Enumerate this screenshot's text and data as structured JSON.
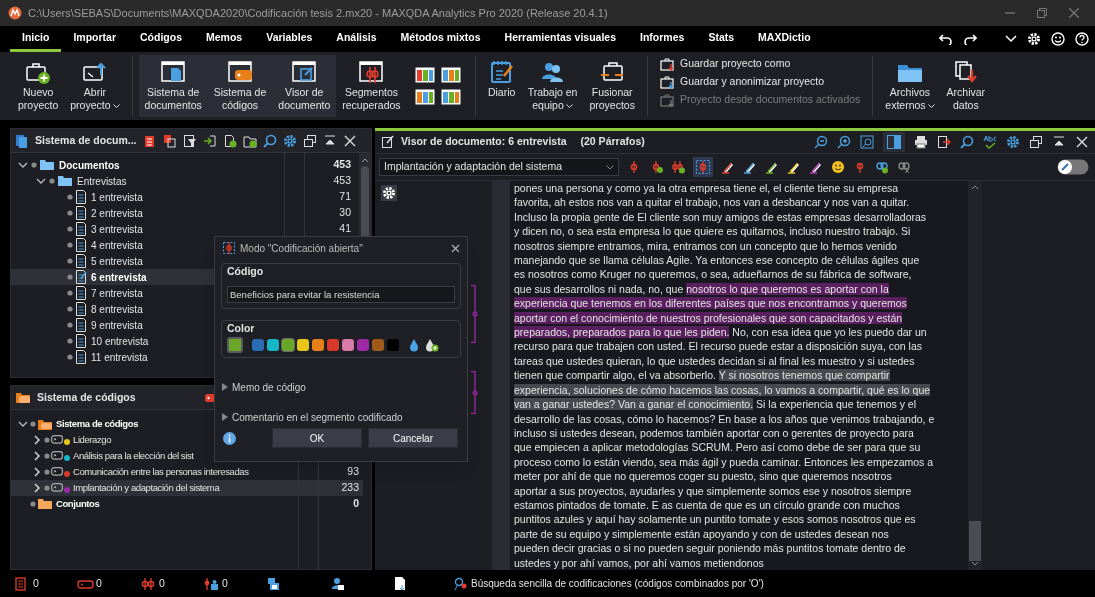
{
  "window": {
    "title": "C:\\Users\\SEBAS\\Documents\\MAXQDA2020\\Codificación tesis 2.mx20 - MAXQDA Analytics Pro 2020 (Release 20.4.1)"
  },
  "menu_tabs": [
    {
      "label": "Inicio",
      "selected": true
    },
    {
      "label": "Importar",
      "selected": false
    },
    {
      "label": "Códigos",
      "selected": false
    },
    {
      "label": "Memos",
      "selected": false
    },
    {
      "label": "Variables",
      "selected": false
    },
    {
      "label": "Análisis",
      "selected": false
    },
    {
      "label": "Métodos mixtos",
      "selected": false
    },
    {
      "label": "Herramientas visuales",
      "selected": false
    },
    {
      "label": "Informes",
      "selected": false
    },
    {
      "label": "Stats",
      "selected": false
    },
    {
      "label": "MAXDictio",
      "selected": false
    }
  ],
  "ribbon_groups": [
    [
      {
        "kind": "large",
        "lines": [
          "Nuevo",
          "proyecto"
        ],
        "dropdown": false,
        "on": false
      },
      {
        "kind": "large",
        "lines": [
          "Abrir",
          "proyecto"
        ],
        "dropdown": true,
        "on": false
      }
    ],
    [
      {
        "kind": "large",
        "lines": [
          "Sistema de",
          "documentos"
        ],
        "dropdown": false,
        "on": true
      },
      {
        "kind": "large",
        "lines": [
          "Sistema de",
          "códigos"
        ],
        "dropdown": false,
        "on": true
      },
      {
        "kind": "large",
        "lines": [
          "Visor de",
          "documento"
        ],
        "dropdown": false,
        "on": true
      },
      {
        "kind": "large",
        "lines": [
          "Segmentos",
          "recuperados"
        ],
        "dropdown": false,
        "on": false
      },
      {
        "kind": "layouts"
      }
    ],
    [
      {
        "kind": "large",
        "lines": [
          "Diario"
        ],
        "dropdown": false,
        "on": false
      },
      {
        "kind": "large",
        "lines": [
          "Trabajo en",
          "equipo"
        ],
        "dropdown": true,
        "on": false
      },
      {
        "kind": "large",
        "lines": [
          "Fusionar",
          "proyectos"
        ],
        "dropdown": false,
        "on": false
      }
    ],
    [
      {
        "kind": "list",
        "entries": [
          {
            "label": "Guardar proyecto como",
            "disabled": false
          },
          {
            "label": "Guardar y anonimizar proyecto",
            "disabled": false
          },
          {
            "label": "Proyecto desde documentos activados",
            "disabled": true
          }
        ]
      }
    ],
    [
      {
        "kind": "large",
        "lines": [
          "Archivos",
          "externos"
        ],
        "dropdown": true,
        "on": false
      },
      {
        "kind": "large",
        "lines": [
          "Archivar",
          "datos"
        ],
        "dropdown": false,
        "on": false
      }
    ]
  ],
  "document_system": {
    "title": "Sistema de docum...",
    "tree": [
      {
        "label": "Documentos",
        "count": "453",
        "kind": "root",
        "expanded": true,
        "selected": false,
        "children": [
          {
            "label": "Entrevistas",
            "count": "453",
            "kind": "folder",
            "expanded": true,
            "selected": false,
            "children": [
              {
                "label": "1 entrevista",
                "count": "71",
                "kind": "document",
                "selected": false
              },
              {
                "label": "2 entrevista",
                "count": "30",
                "kind": "document",
                "selected": false
              },
              {
                "label": "3 entrevista",
                "count": "41",
                "kind": "document",
                "selected": false
              },
              {
                "label": "4 entrevista",
                "kind": "document",
                "selected": false
              },
              {
                "label": "5 entrevista",
                "kind": "document",
                "selected": false
              },
              {
                "label": "6 entrevista",
                "kind": "document",
                "selected": true
              },
              {
                "label": "7 entrevista",
                "kind": "document",
                "selected": false
              },
              {
                "label": "8 entrevista",
                "kind": "document",
                "selected": false
              },
              {
                "label": "9 entrevista",
                "kind": "document",
                "selected": false
              },
              {
                "label": "10 entrevista",
                "kind": "document",
                "selected": false
              },
              {
                "label": "11 entrevista",
                "kind": "document",
                "selected": false
              }
            ]
          }
        ]
      }
    ]
  },
  "code_system": {
    "title": "Sistema de códigos",
    "tree": [
      {
        "label": "Sistema de códigos",
        "kind": "root",
        "expanded": true,
        "selected": false,
        "children": [
          {
            "label": "Liderazgo",
            "kind": "code",
            "color": "#e8c619",
            "expanded": false,
            "selected": false
          },
          {
            "label": "Análisis para la elección del sist",
            "kind": "code",
            "color": "#17b5c8",
            "expanded": false,
            "selected": false
          },
          {
            "label": "Comunicación entre las personas interesadas",
            "count": "93",
            "kind": "code",
            "color": "#d83a2a",
            "expanded": false,
            "selected": false
          },
          {
            "label": "Implantación y adaptación del sistema",
            "count": "233",
            "kind": "code",
            "color": "#9b2aa4",
            "expanded": false,
            "selected": true
          }
        ]
      },
      {
        "label": "Conjuntos",
        "count": "0",
        "kind": "sets",
        "selected": false
      }
    ]
  },
  "document_viewer": {
    "title": "Visor de documento: 6 entrevista",
    "paragraph_count": "(20 Párrafos)",
    "code_dropdown": "Implantación y adaptación del sistema",
    "edit_toggle": {
      "on": false
    },
    "lines": [
      [
        {
          "text": "pones una persona y como ya la otra empresa tiene el, el cliente tiene su empresa",
          "kind": "plain"
        }
      ],
      [
        {
          "text": "favorita, ah estos nos van a quitar el trabajo, nos van a desbancar y nos van a quitar.",
          "kind": "plain"
        }
      ],
      [
        {
          "text": "Incluso la propia gente de El cliente son muy amigos de estas empresas desarrolladoras",
          "kind": "plain"
        }
      ],
      [
        {
          "text": "y dicen no, o sea esta empresa lo que quiere es quitarnos, incluso nuestro trabajo. Si",
          "kind": "plain"
        }
      ],
      [
        {
          "text": "nosotros siempre entramos, mira, entramos con un concepto que lo hemos venido",
          "kind": "plain"
        }
      ],
      [
        {
          "text": "manejando que se llama células Agile. Ya entonces ese concepto de células ágiles que",
          "kind": "plain"
        }
      ],
      [
        {
          "text": "es nosotros como Kruger no queremos, o sea, adueñarnos de su fábrica de software,",
          "kind": "plain"
        }
      ],
      [
        {
          "text": "que sus desarrollos ni nada, no, que ",
          "kind": "plain"
        },
        {
          "text": "nosotros lo que queremos es aportar con la",
          "kind": "coded"
        }
      ],
      [
        {
          "text": "experiencia que tenemos en los diferentes países que nos encontramos y queremos",
          "kind": "coded"
        }
      ],
      [
        {
          "text": "aportar con el conocimiento de nuestros profesionales que son capacitados y están",
          "kind": "coded"
        }
      ],
      [
        {
          "text": "preparados, preparados para lo que les piden.",
          "kind": "coded"
        },
        {
          "text": " No, con esa idea que yo les puedo dar un",
          "kind": "plain"
        }
      ],
      [
        {
          "text": "recurso para que trabajen con usted. El recurso puede estar a disposición suya, con las",
          "kind": "plain"
        }
      ],
      [
        {
          "text": "tareas que ustedes quieran, lo que ustedes decidan si al final les muestro y si ustedes",
          "kind": "plain"
        }
      ],
      [
        {
          "text": "tienen que compartir algo, el va absorberlo. ",
          "kind": "plain"
        },
        {
          "text": "Y si nosotros tenemos que compartir",
          "kind": "selected"
        }
      ],
      [
        {
          "text": "experiencia, soluciones de cómo hacemos las cosas, lo vamos a compartir, qué es lo que",
          "kind": "selected"
        }
      ],
      [
        {
          "text": "van a ganar ustedes? Van a ganar el conocimiento.",
          "kind": "selected"
        },
        {
          "text": " Si la experiencia que tenemos y el",
          "kind": "plain"
        }
      ],
      [
        {
          "text": "desarrollo de las cosas, cómo lo hacemos? En base a los años que venimos trabajando, e",
          "kind": "plain"
        }
      ],
      [
        {
          "text": "incluso si ustedes desean, podemos también aportar con o gerentes de proyecto para",
          "kind": "plain"
        }
      ],
      [
        {
          "text": "que empiecen a aplicar metodologías SCRUM. Pero así como debe de ser para que su",
          "kind": "plain"
        }
      ],
      [
        {
          "text": "proceso como lo están viendo, sea más ágil y pueda caminar. Entonces les empezamos a",
          "kind": "plain"
        }
      ],
      [
        {
          "text": "meter por ahí de que no queremos coger su puesto, sino que queremos nosotros",
          "kind": "plain"
        }
      ],
      [
        {
          "text": "aportar a sus proyectos, ayudarles y que simplemente somos ese y nosotros siempre",
          "kind": "plain"
        }
      ],
      [
        {
          "text": "estamos pintados de tomate. E as cuenta de que es un círculo grande con muchos",
          "kind": "plain"
        }
      ],
      [
        {
          "text": "puntitos azules y aquí hay solamente un puntito tomate y esos somos nosotros que es",
          "kind": "plain"
        }
      ],
      [
        {
          "text": "parte de su equipo y simplemente están apoyando y con de ustedes desean nos",
          "kind": "plain"
        }
      ],
      [
        {
          "text": "pueden decir gracias o si no pueden seguir poniendo más puntitos tomate dentro de",
          "kind": "plain"
        }
      ],
      [
        {
          "text": "ustedes y por ahí vamos, por ahí vamos metiendonos",
          "kind": "plain"
        }
      ]
    ]
  },
  "dialog": {
    "title": "Modo \"Codificación abierta\"",
    "code_label": "Código",
    "code_value": "Beneficios para evitar la resistencia",
    "color_label": "Color",
    "swatches": [
      {
        "color": "#2a6db5",
        "selected": false
      },
      {
        "color": "#17b5c8",
        "selected": false
      },
      {
        "color": "#6aa628",
        "selected": true
      },
      {
        "color": "#e8c619",
        "selected": false
      },
      {
        "color": "#e8801a",
        "selected": false
      },
      {
        "color": "#d83a2a",
        "selected": false
      },
      {
        "color": "#d77aa6",
        "selected": false
      },
      {
        "color": "#9b2aa4",
        "selected": false
      },
      {
        "color": "#a05a1c",
        "selected": false
      },
      {
        "color": "#000000",
        "selected": false
      }
    ],
    "sections": [
      {
        "label": "Memo de código",
        "expanded": false
      },
      {
        "label": "Comentario en el segmento codificado",
        "expanded": false
      }
    ],
    "buttons": [
      "OK",
      "Cancelar"
    ]
  },
  "status_bar": {
    "counters": [
      "0",
      "0",
      "0",
      "0"
    ],
    "message": "Búsqueda sencilla de codificaciones (códigos combinados por 'O')"
  }
}
